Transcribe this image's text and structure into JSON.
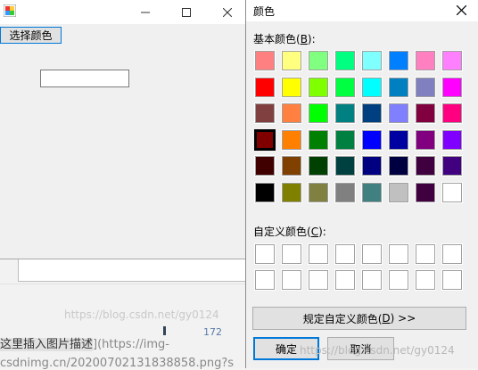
{
  "background": {
    "watermark_left": "https://blog.csdn.net/gy0124",
    "line1": "这里插入图片描述](https://img-",
    "line1_prefix": "这里插入图片描述",
    "line1_suffix": "](https://img-",
    "line2": "csdnimg.cn/20200702131838858.png?s",
    "number": "172"
  },
  "main_window": {
    "title": "",
    "choose_color_label": "选择颜色",
    "text_box_value": ""
  },
  "dialog": {
    "title": "颜色",
    "close_label": "✕",
    "basic_colors_label": "基本颜色(",
    "basic_colors_key": "B",
    "basic_colors_end": "):",
    "custom_colors_label": "自定义颜色(",
    "custom_colors_key": "C",
    "custom_colors_end": "):",
    "define_custom_label": "规定自定义颜色(",
    "define_custom_key": "D",
    "define_custom_end": ") >>",
    "ok_label": "确定",
    "cancel_label": "取消",
    "watermark": "https://blog.csdn.net/gy0124"
  },
  "basic_colors": [
    [
      "#ff8080",
      "#ffff80",
      "#80ff80",
      "#00ff80",
      "#80ffff",
      "#0080ff",
      "#ff80c0",
      "#ff80ff"
    ],
    [
      "#ff0000",
      "#ffff00",
      "#80ff00",
      "#00ff40",
      "#00ffff",
      "#0080c0",
      "#8080c0",
      "#ff00ff"
    ],
    [
      "#804040",
      "#ff8040",
      "#00ff00",
      "#008080",
      "#004080",
      "#8080ff",
      "#800040",
      "#ff0080"
    ],
    [
      "#800000",
      "#ff8000",
      "#008000",
      "#008040",
      "#0000ff",
      "#0000a0",
      "#800080",
      "#8000ff"
    ],
    [
      "#400000",
      "#804000",
      "#004000",
      "#004040",
      "#000080",
      "#000040",
      "#400040",
      "#400080"
    ],
    [
      "#000000",
      "#808000",
      "#808040",
      "#808080",
      "#408080",
      "#c0c0c0",
      "#400040",
      "#ffffff"
    ]
  ],
  "selected_color": {
    "row": 3,
    "col": 0
  },
  "custom_colors_count": 16
}
